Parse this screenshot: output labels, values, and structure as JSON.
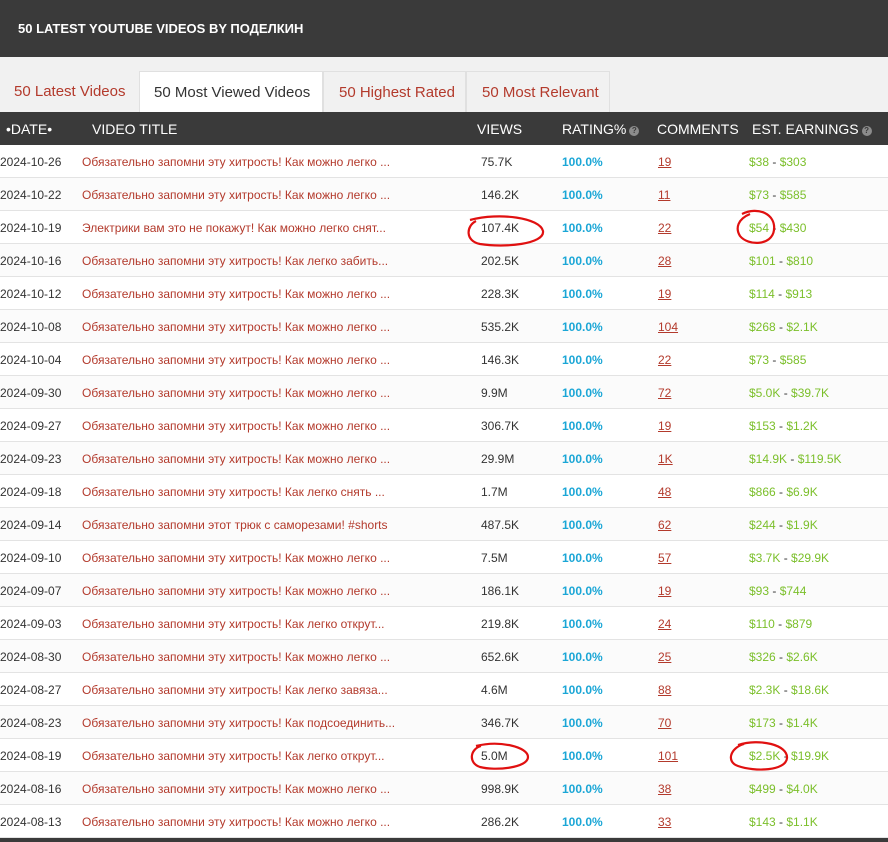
{
  "header": {
    "title": "50 LATEST YOUTUBE VIDEOS BY ПОДЕЛКИН"
  },
  "tabs": [
    {
      "label": "50 Latest Videos"
    },
    {
      "label": "50 Most Viewed Videos"
    },
    {
      "label": "50 Highest Rated"
    },
    {
      "label": "50 Most Relevant"
    }
  ],
  "columns": {
    "date": "•DATE•",
    "title": "VIDEO TITLE",
    "views": "VIEWS",
    "rating": "RATING%",
    "comments": "COMMENTS",
    "earnings": "EST. EARNINGS",
    "help_icon": "?"
  },
  "rows": [
    {
      "date": "2024-10-26",
      "title": "Обязательно запомни эту хитрость! Как можно легко ...",
      "views": "75.7K",
      "rating": "100.0%",
      "comments": "19",
      "earn_low": "$38",
      "earn_high": "$303"
    },
    {
      "date": "2024-10-22",
      "title": "Обязательно запомни эту хитрость! Как можно легко ...",
      "views": "146.2K",
      "rating": "100.0%",
      "comments": "11",
      "earn_low": "$73",
      "earn_high": "$585"
    },
    {
      "date": "2024-10-19",
      "title": "Электрики вам это не покажут! Как можно легко снят...",
      "views": "107.4K",
      "rating": "100.0%",
      "comments": "22",
      "earn_low": "$54",
      "earn_high": "$430"
    },
    {
      "date": "2024-10-16",
      "title": "Обязательно запомни эту хитрость! Как легко забить...",
      "views": "202.5K",
      "rating": "100.0%",
      "comments": "28",
      "earn_low": "$101",
      "earn_high": "$810"
    },
    {
      "date": "2024-10-12",
      "title": "Обязательно запомни эту хитрость! Как можно легко ...",
      "views": "228.3K",
      "rating": "100.0%",
      "comments": "19",
      "earn_low": "$114",
      "earn_high": "$913"
    },
    {
      "date": "2024-10-08",
      "title": "Обязательно запомни эту хитрость! Как можно легко ...",
      "views": "535.2K",
      "rating": "100.0%",
      "comments": "104",
      "earn_low": "$268",
      "earn_high": "$2.1K"
    },
    {
      "date": "2024-10-04",
      "title": "Обязательно запомни эту хитрость! Как можно легко ...",
      "views": "146.3K",
      "rating": "100.0%",
      "comments": "22",
      "earn_low": "$73",
      "earn_high": "$585"
    },
    {
      "date": "2024-09-30",
      "title": "Обязательно запомни эту хитрость! Как можно легко ...",
      "views": "9.9M",
      "rating": "100.0%",
      "comments": "72",
      "earn_low": "$5.0K",
      "earn_high": "$39.7K"
    },
    {
      "date": "2024-09-27",
      "title": "Обязательно запомни эту хитрость! Как можно легко ...",
      "views": "306.7K",
      "rating": "100.0%",
      "comments": "19",
      "earn_low": "$153",
      "earn_high": "$1.2K"
    },
    {
      "date": "2024-09-23",
      "title": "Обязательно запомни эту хитрость! Как можно легко ...",
      "views": "29.9M",
      "rating": "100.0%",
      "comments": "1K",
      "earn_low": "$14.9K",
      "earn_high": "$119.5K"
    },
    {
      "date": "2024-09-18",
      "title": "Обязательно запомни эту хитрость! Как легко снять ...",
      "views": "1.7M",
      "rating": "100.0%",
      "comments": "48",
      "earn_low": "$866",
      "earn_high": "$6.9K"
    },
    {
      "date": "2024-09-14",
      "title": "Обязательно запомни этот трюк с саморезами! #shorts",
      "views": "487.5K",
      "rating": "100.0%",
      "comments": "62",
      "earn_low": "$244",
      "earn_high": "$1.9K"
    },
    {
      "date": "2024-09-10",
      "title": "Обязательно запомни эту хитрость! Как можно легко ...",
      "views": "7.5M",
      "rating": "100.0%",
      "comments": "57",
      "earn_low": "$3.7K",
      "earn_high": "$29.9K"
    },
    {
      "date": "2024-09-07",
      "title": "Обязательно запомни эту хитрость! Как можно легко ...",
      "views": "186.1K",
      "rating": "100.0%",
      "comments": "19",
      "earn_low": "$93",
      "earn_high": "$744"
    },
    {
      "date": "2024-09-03",
      "title": "Обязательно запомни эту хитрость! Как легко открут...",
      "views": "219.8K",
      "rating": "100.0%",
      "comments": "24",
      "earn_low": "$110",
      "earn_high": "$879"
    },
    {
      "date": "2024-08-30",
      "title": "Обязательно запомни эту хитрость! Как можно легко ...",
      "views": "652.6K",
      "rating": "100.0%",
      "comments": "25",
      "earn_low": "$326",
      "earn_high": "$2.6K"
    },
    {
      "date": "2024-08-27",
      "title": "Обязательно запомни эту хитрость! Как легко завяза...",
      "views": "4.6M",
      "rating": "100.0%",
      "comments": "88",
      "earn_low": "$2.3K",
      "earn_high": "$18.6K"
    },
    {
      "date": "2024-08-23",
      "title": "Обязательно запомни эту хитрость! Как подсоединить...",
      "views": "346.7K",
      "rating": "100.0%",
      "comments": "70",
      "earn_low": "$173",
      "earn_high": "$1.4K"
    },
    {
      "date": "2024-08-19",
      "title": "Обязательно запомни эту хитрость! Как легко открут...",
      "views": "5.0M",
      "rating": "100.0%",
      "comments": "101",
      "earn_low": "$2.5K",
      "earn_high": "$19.9K"
    },
    {
      "date": "2024-08-16",
      "title": "Обязательно запомни эту хитрость! Как можно легко ...",
      "views": "998.9K",
      "rating": "100.0%",
      "comments": "38",
      "earn_low": "$499",
      "earn_high": "$4.0K"
    },
    {
      "date": "2024-08-13",
      "title": "Обязательно запомни эту хитрость! Как можно легко ...",
      "views": "286.2K",
      "rating": "100.0%",
      "comments": "33",
      "earn_low": "$143",
      "earn_high": "$1.1K"
    }
  ],
  "earn_separator": " - ",
  "colors": {
    "accent_red": "#b33a2c",
    "rating_blue": "#1aa6d6",
    "earnings_green": "#7bbf2a",
    "header_dark": "#3a3a3a",
    "annotation_red": "#e01010"
  }
}
